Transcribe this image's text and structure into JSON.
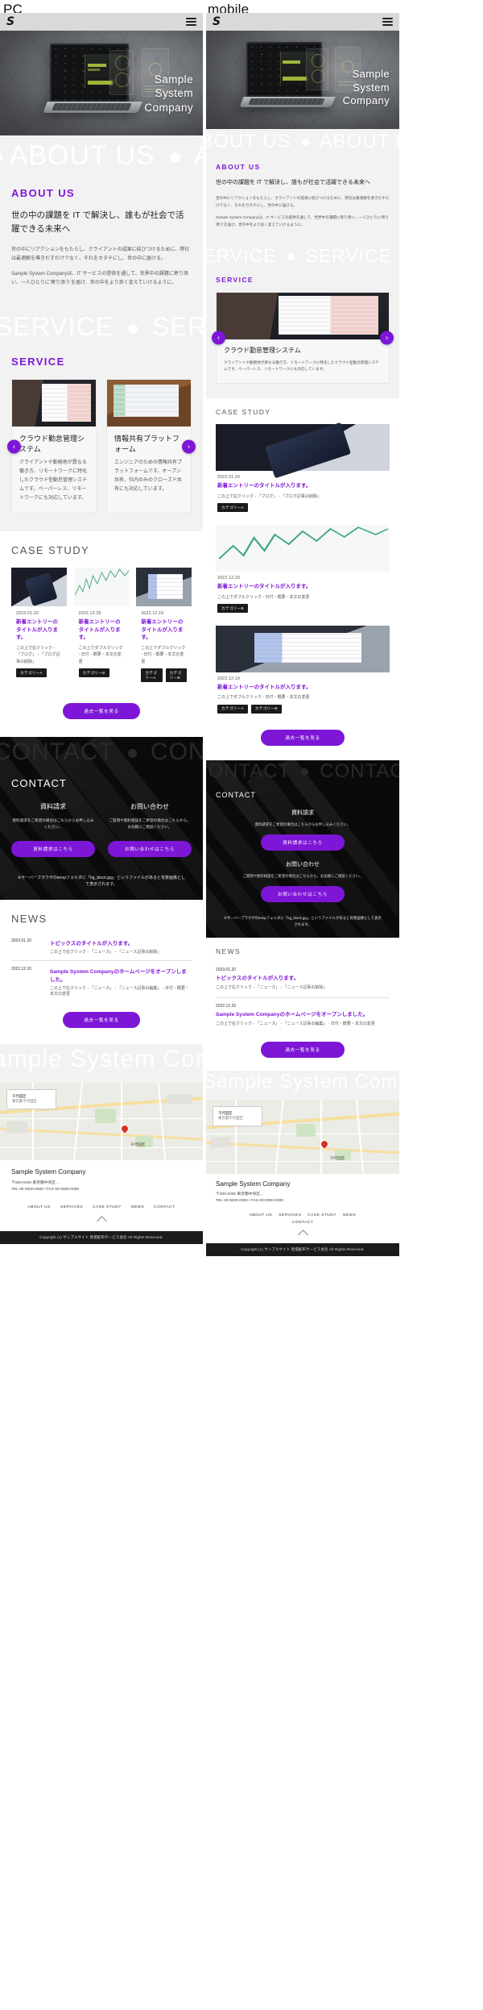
{
  "labels": {
    "pc": "PC",
    "mobile": "mobile"
  },
  "header": {
    "logo": "S",
    "menu_icon": "hamburger-icon"
  },
  "hero": {
    "title_lines": [
      "Sample",
      "System",
      "Company"
    ]
  },
  "ghost": {
    "about": "ABOUT US",
    "service": "SERVICE",
    "contact": "CONTACT",
    "company": "Sample Company"
  },
  "about": {
    "heading": "ABOUT US",
    "lead": "世の中の課題を IT で解決し、誰もが社会で活躍できる未来へ",
    "paragraphs": [
      "世の中にリアクションをもたらし、クライアントの成果に結びつけるために、弊社は最適解を導きだすだけでなく、それをカタチにし、世の中に届ける。",
      "Sample System Companyは、IT サービスの提供を通して、世界中の課題に寄り添い、一人ひとりに'寄り添う'を届け、世の中をより良く変えていけるように。"
    ]
  },
  "service": {
    "heading": "SERVICE",
    "prev_icon": "chevron-left-icon",
    "next_icon": "chevron-right-icon",
    "cards": [
      {
        "title": "クラウド勤怠管理システム",
        "desc": "クライアントや勤務地が異なる働き方、リモートワークに特化したクラウド型勤怠管理システムです。ペーパーレス、リモートワークにも対応しています。",
        "image": "woman-at-laptop-photo"
      },
      {
        "title": "情報共有プラットフォーム",
        "desc": "エンジニアのための情報共有プラットフォームです。オープン共有、社内のみのクローズド共有にも対応しています。",
        "image": "desk-with-tablet-photo"
      }
    ]
  },
  "case_study": {
    "heading": "CASE STUDY",
    "more_button": "過去一覧を見る",
    "items": [
      {
        "date": "2023.01.20",
        "title": "新着エントリーのタイトルが入ります。",
        "desc": "この上で右クリック - 「ブログ」 - 「ブログ記事の削除」",
        "tags": [
          "カテゴリーA"
        ],
        "image": "phone-on-laptop-photo"
      },
      {
        "date": "2022.12.20",
        "title": "新着エントリーのタイトルが入ります。",
        "desc": "この上でダブルクリック - 日付・概要・本文の変更",
        "tags": [
          "カテゴリーB"
        ],
        "image": "green-line-graph-photo"
      },
      {
        "date": "2022.12.19",
        "title": "新着エントリーのタイトルが入ります。",
        "desc": "この上でダブルクリック - 日付・概要・本文の変更",
        "tags": [
          "カテゴリーA",
          "カテゴリーB"
        ],
        "image": "laptop-dashboard-photo"
      }
    ]
  },
  "contact": {
    "heading": "CONTACT",
    "columns": [
      {
        "title": "資料請求",
        "desc": "資料請求をご希望の場合はこちらからお申し込みください。",
        "button": "資料請求はこちら"
      },
      {
        "title": "お問い合わせ",
        "desc": "ご質問や無料相談をご希望の場合はこちらから。お気軽にご相談ください。",
        "button": "お問い合わせはこちら"
      }
    ],
    "note": "※サーバーブラウザのtempフォルダに「bg_block.jpg」というファイルがあると背景画像として表示されます。"
  },
  "news": {
    "heading": "NEWS",
    "more_button": "過去一覧を見る",
    "items": [
      {
        "date": "2023.01.20",
        "title": "トピックスのタイトルが入ります。",
        "desc": "この上で右クリック - 「ニュース」 - 「ニュース記事の削除」"
      },
      {
        "date": "2022.12.20",
        "title": "Sample System Companyのホームページをオープンしました。",
        "desc": "この上で右クリック - 「ニュース」 - 「ニュース記事の編集」 - 日付・概要・本文の変更"
      }
    ]
  },
  "map": {
    "card_title": "千代田区",
    "card_sub": "東京都千代田区",
    "label1": "千代田区",
    "pin_icon": "map-pin-icon"
  },
  "footer": {
    "company": "Sample System Company",
    "address": "〒000-0000 東京都中央区…",
    "tel": "TEL 00-0000-0000 / FAX 00-0000-0000",
    "nav": [
      "ABOUT US",
      "SERVICES",
      "CASE STUDY",
      "NEWS",
      "CONTACT"
    ],
    "scroll_icon": "chevron-up-icon",
    "copyright": "Copyright (c) サンプルサイト 無償配布サービス会社 All Rights Reserved."
  }
}
